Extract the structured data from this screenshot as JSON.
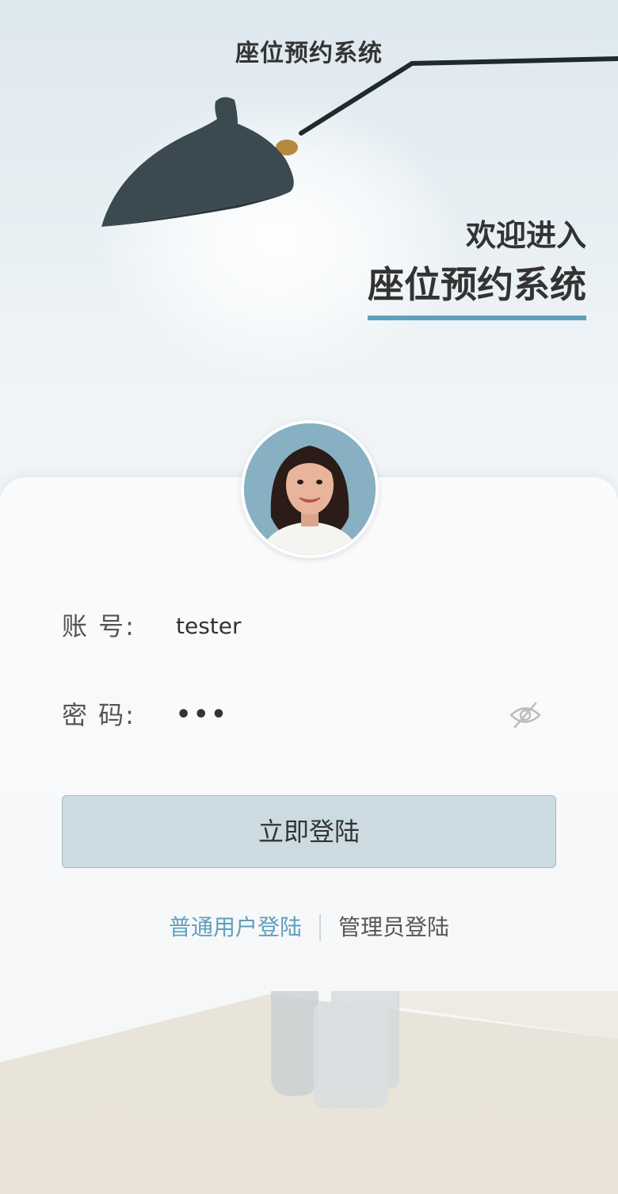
{
  "header": {
    "title": "座位预约系统"
  },
  "welcome": {
    "line1": "欢迎进入",
    "system_name": "座位预约系统"
  },
  "login_form": {
    "account_label": "账 号:",
    "account_value": "tester",
    "password_label": "密 码:",
    "password_mask": "•••",
    "submit_label": "立即登陆"
  },
  "login_modes": {
    "user_label": "普通用户登陆",
    "admin_label": "管理员登陆",
    "active": "user"
  },
  "icons": {
    "avatar": "user-avatar",
    "password_toggle": "eye-hidden-icon"
  },
  "colors": {
    "accent": "#5f9fbd",
    "button_bg": "#ccdbe2",
    "text": "#333333"
  }
}
